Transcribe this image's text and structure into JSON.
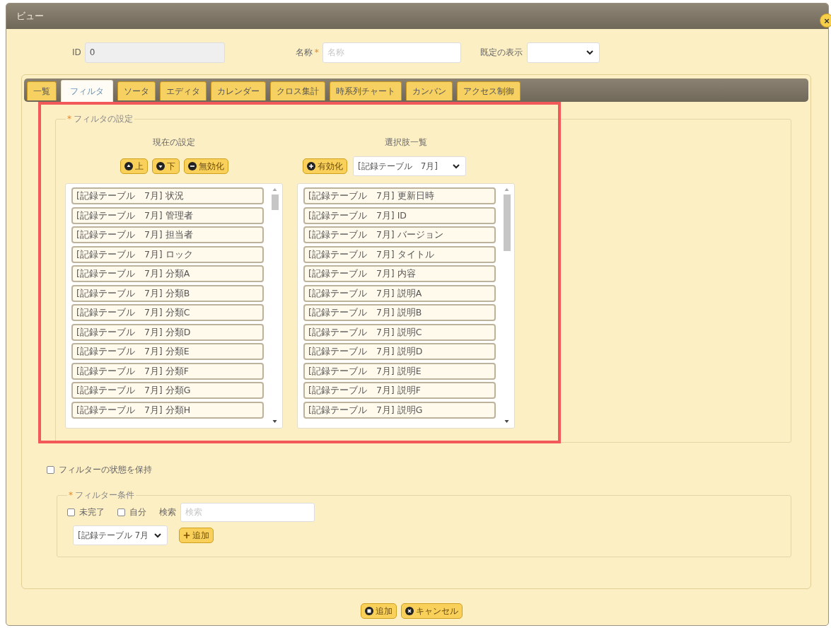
{
  "window": {
    "title": "ビュー",
    "close_label": "×"
  },
  "fields": {
    "id": {
      "label": "ID",
      "value": "0",
      "disabled": true
    },
    "name": {
      "label": "名称",
      "required_mark": "*",
      "placeholder": "名称"
    },
    "default_display": {
      "label": "既定の表示"
    }
  },
  "tabs": [
    {
      "label": "一覧",
      "selected": false
    },
    {
      "label": "フィルタ",
      "selected": true
    },
    {
      "label": "ソータ",
      "selected": false
    },
    {
      "label": "エディタ",
      "selected": false
    },
    {
      "label": "カレンダー",
      "selected": false
    },
    {
      "label": "クロス集計",
      "selected": false
    },
    {
      "label": "時系列チャート",
      "selected": false
    },
    {
      "label": "カンバン",
      "selected": false
    },
    {
      "label": "アクセス制御",
      "selected": false
    }
  ],
  "filter_settings": {
    "mark": "*",
    "legend": "フィルタの設定",
    "current": {
      "heading": "現在の設定",
      "buttons": [
        {
          "label": "上",
          "kind": "up"
        },
        {
          "label": "下",
          "kind": "down"
        },
        {
          "label": "無効化",
          "kind": "disable"
        }
      ],
      "items": [
        "[記録テーブル　7月] 状況",
        "[記録テーブル　7月] 管理者",
        "[記録テーブル　7月] 担当者",
        "[記録テーブル　7月] ロック",
        "[記録テーブル　7月] 分類A",
        "[記録テーブル　7月] 分類B",
        "[記録テーブル　7月] 分類C",
        "[記録テーブル　7月] 分類D",
        "[記録テーブル　7月] 分類E",
        "[記録テーブル　7月] 分類F",
        "[記録テーブル　7月] 分類G",
        "[記録テーブル　7月] 分類H"
      ]
    },
    "available": {
      "heading": "選択肢一覧",
      "buttons": [
        {
          "label": "有効化",
          "kind": "enable"
        }
      ],
      "select_value": "[記録テーブル　7月]",
      "items": [
        "[記録テーブル　7月] 更新日時",
        "[記録テーブル　7月] ID",
        "[記録テーブル　7月] バージョン",
        "[記録テーブル　7月] タイトル",
        "[記録テーブル　7月] 内容",
        "[記録テーブル　7月] 説明A",
        "[記録テーブル　7月] 説明B",
        "[記録テーブル　7月] 説明C",
        "[記録テーブル　7月] 説明D",
        "[記録テーブル　7月] 説明E",
        "[記録テーブル　7月] 説明F",
        "[記録テーブル　7月] 説明G"
      ]
    }
  },
  "keep_filter_state": {
    "label": "フィルターの状態を保持",
    "checked": false
  },
  "filter_conditions": {
    "mark": "*",
    "legend": "フィルター条件",
    "checks": [
      {
        "label": "未完了",
        "checked": false
      },
      {
        "label": "自分",
        "checked": false
      }
    ],
    "search": {
      "label": "検索",
      "placeholder": "検索"
    },
    "column_select": "[記録テーブル 7月",
    "add_button": {
      "label": "追加",
      "kind": "add"
    }
  },
  "buttons": [
    {
      "label": "追加",
      "kind": "save"
    },
    {
      "label": "キャンセル",
      "kind": "cancel"
    }
  ]
}
